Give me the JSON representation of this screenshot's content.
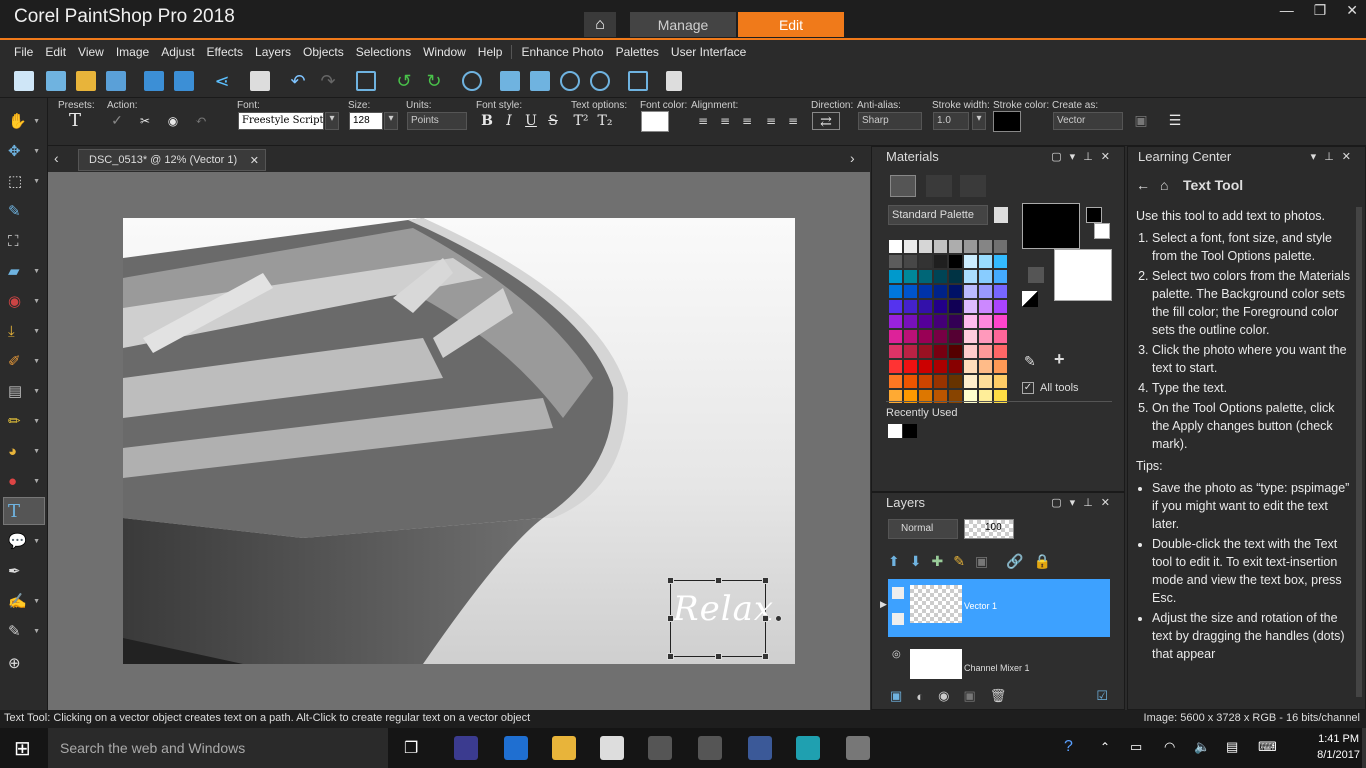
{
  "app": {
    "title": "Corel PaintShop Pro 2018",
    "tabs": {
      "manage": "Manage",
      "edit": "Edit"
    }
  },
  "window_controls": {
    "minimize": "—",
    "restore": "❐",
    "close": "✕"
  },
  "menu": [
    "File",
    "Edit",
    "View",
    "Image",
    "Adjust",
    "Effects",
    "Layers",
    "Objects",
    "Selections",
    "Window",
    "Help",
    "Enhance Photo",
    "Palettes",
    "User Interface"
  ],
  "tool_options": {
    "presets_label": "Presets:",
    "action_label": "Action:",
    "font_label": "Font:",
    "font_value": "Freestyle Script",
    "size_label": "Size:",
    "size_value": "128",
    "units_label": "Units:",
    "units_value": "Points",
    "font_style_label": "Font style:",
    "text_options_label": "Text options:",
    "font_color_label": "Font color:",
    "alignment_label": "Alignment:",
    "direction_label": "Direction:",
    "antialias_label": "Anti-alias:",
    "antialias_value": "Sharp",
    "stroke_width_label": "Stroke width:",
    "stroke_width_value": "1.0",
    "stroke_color_label": "Stroke color:",
    "create_as_label": "Create as:",
    "create_as_value": "Vector",
    "style_buttons": [
      "B",
      "I",
      "U",
      "S"
    ]
  },
  "document": {
    "tab_title": "DSC_0513* @  12% (Vector 1)",
    "canvas_text": "Relax"
  },
  "materials": {
    "title": "Materials",
    "palette_select": "Standard Palette",
    "all_tools": "All tools",
    "recently_used": "Recently Used",
    "swatches": [
      "#ffffff",
      "#ebebeb",
      "#d6d6d6",
      "#c2c2c2",
      "#adadad",
      "#999999",
      "#858585",
      "#707070",
      "#5c5c5c",
      "#474747",
      "#333333",
      "#1f1f1f",
      "#000000",
      "#cceeff",
      "#99ddff",
      "#33bbff",
      "#0099cc",
      "#008899",
      "#006677",
      "#004455",
      "#003344",
      "#aaddff",
      "#88ccff",
      "#44aaff",
      "#0077dd",
      "#0055cc",
      "#0033aa",
      "#002288",
      "#001166",
      "#bbbbff",
      "#9999ff",
      "#7766ff",
      "#5533ee",
      "#4422cc",
      "#3311aa",
      "#220088",
      "#110055",
      "#ddbbff",
      "#cc88ff",
      "#aa44ff",
      "#9922dd",
      "#7711bb",
      "#550099",
      "#440077",
      "#330055",
      "#ffbbee",
      "#ff88dd",
      "#ff44cc",
      "#dd2299",
      "#bb1177",
      "#990055",
      "#770044",
      "#550033",
      "#ffccdd",
      "#ff99bb",
      "#ff6699",
      "#dd3366",
      "#bb2244",
      "#991122",
      "#770011",
      "#550000",
      "#ffcccc",
      "#ff9999",
      "#ff6666",
      "#ff3333",
      "#ee1111",
      "#cc0000",
      "#aa0000",
      "#880000",
      "#ffddbb",
      "#ffbb88",
      "#ff9955",
      "#ff7722",
      "#ee5500",
      "#cc4400",
      "#993300",
      "#663300",
      "#ffeecc",
      "#ffdd99",
      "#ffcc66",
      "#ffaa33",
      "#ff9900",
      "#dd7700",
      "#bb5500",
      "#884400",
      "#ffffcc",
      "#ffee99",
      "#ffdd44"
    ],
    "recent": [
      "#ffffff",
      "#000000"
    ]
  },
  "layers": {
    "title": "Layers",
    "blend_mode": "Normal",
    "opacity": "100",
    "items": [
      {
        "name": "Vector 1",
        "selected": true
      },
      {
        "name": "Channel Mixer 1",
        "selected": false
      }
    ]
  },
  "learning": {
    "title": "Learning Center",
    "heading": "Text Tool",
    "intro": "Use this tool to add text to photos.",
    "steps": [
      "Select a font, font size, and style from the Tool Options palette.",
      "Select two colors from the Materials palette. The Background color sets the fill color; the Foreground color sets the outline color.",
      "Click the photo where you want the text to start.",
      "Type the text.",
      "On the Tool Options palette, click the Apply changes button (check mark)."
    ],
    "tips_label": "Tips:",
    "tips": [
      "Save the photo as “type: pspimage” if you might want to edit the text later.",
      "Double-click the text with the Text tool to edit it. To exit text-insertion mode and view the text box, press Esc.",
      "Adjust the size and rotation of the text by dragging the handles (dots) that appear"
    ]
  },
  "status": {
    "message": "Text Tool: Clicking on a vector object creates text on a path. Alt-Click to create regular text on a vector object",
    "image_info": "Image:  5600 x 3728 x RGB - 16 bits/channel"
  },
  "taskbar": {
    "search_placeholder": "Search the web and Windows",
    "time": "1:41 PM",
    "date": "8/1/2017"
  },
  "colors": {
    "accent": "#f07a1a",
    "selection": "#3da1ff"
  }
}
